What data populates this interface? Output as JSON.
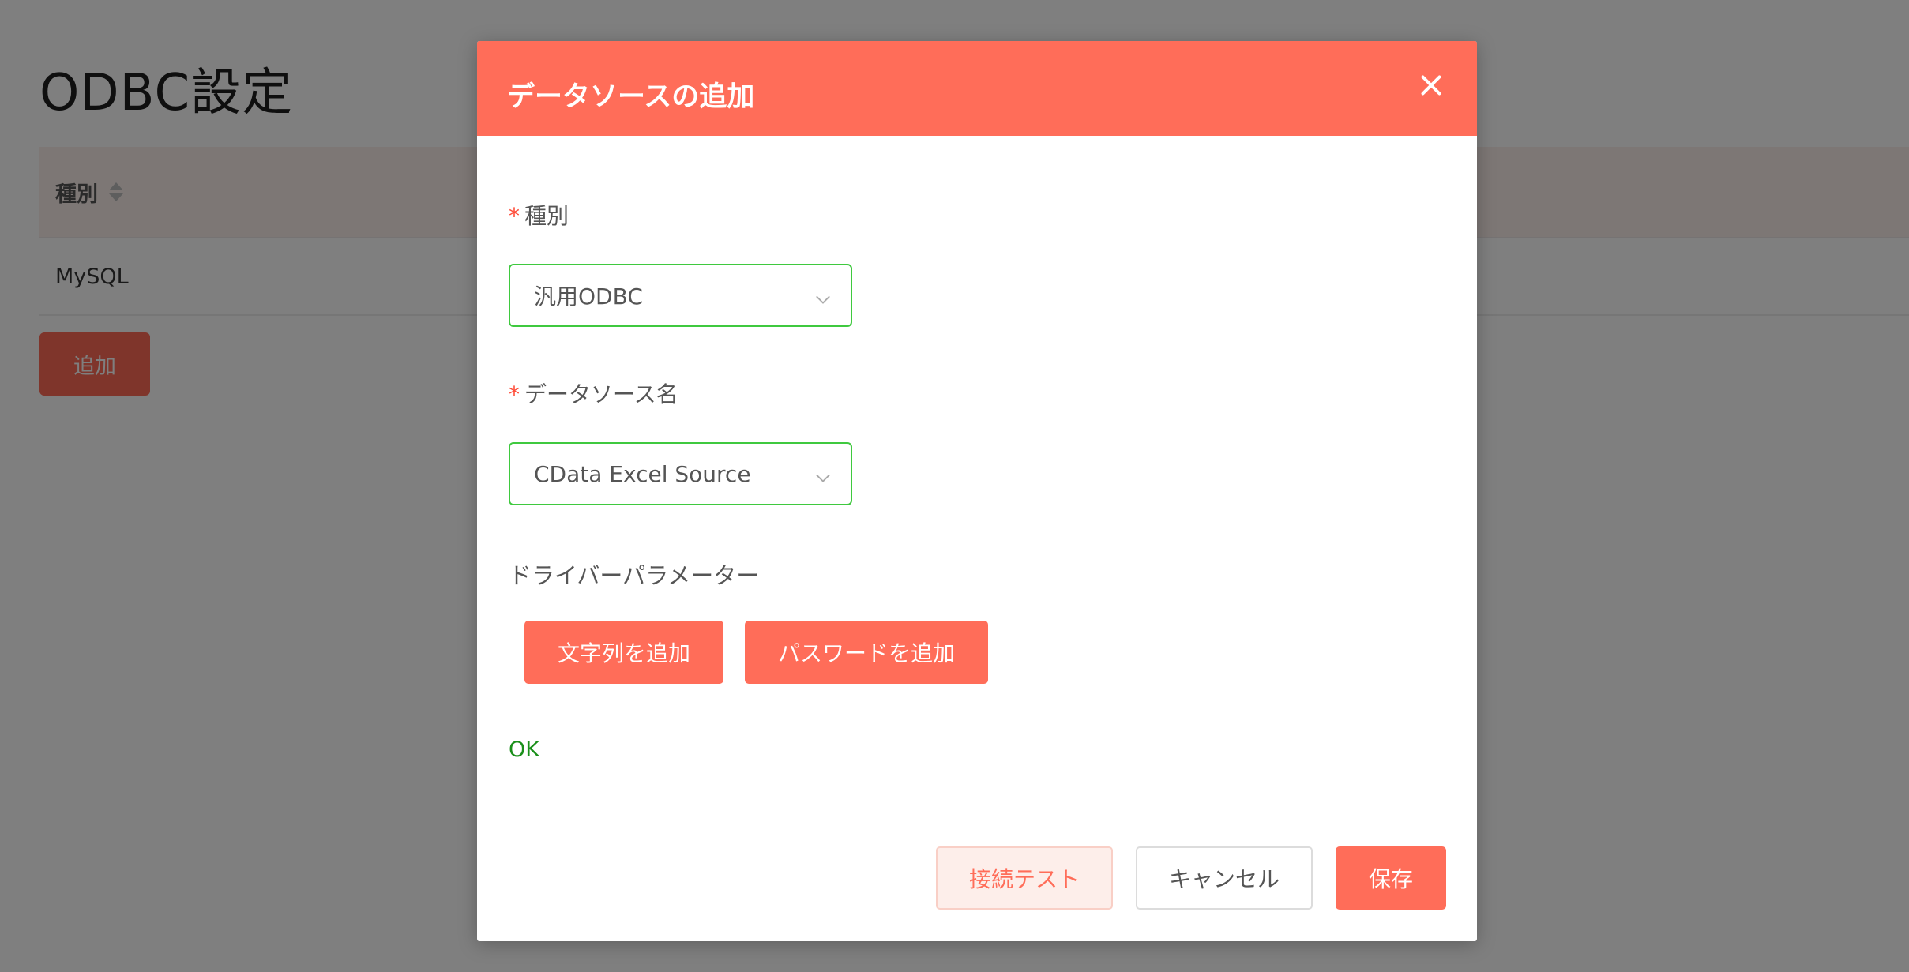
{
  "page": {
    "title": "ODBC設定",
    "table": {
      "columns": [
        {
          "label": "種別"
        }
      ],
      "rows": [
        {
          "type": "MySQL"
        }
      ]
    },
    "add_button_label": "追加"
  },
  "dialog": {
    "title": "データソースの追加",
    "close_icon": "close-icon",
    "fields": {
      "type": {
        "required_mark": "*",
        "label": "種別",
        "value": "汎用ODBC"
      },
      "datasource_name": {
        "required_mark": "*",
        "label": "データソース名",
        "value": "CData Excel Source"
      }
    },
    "driver_params": {
      "label": "ドライバーパラメーター",
      "add_string_label": "文字列を追加",
      "add_password_label": "パスワードを追加"
    },
    "status_text": "OK",
    "footer": {
      "test_label": "接続テスト",
      "cancel_label": "キャンセル",
      "save_label": "保存"
    }
  },
  "colors": {
    "accent": "#ff6d59",
    "valid_border": "#3fc93f",
    "ok_text": "#1a8f1a",
    "overlay": "rgba(0,0,0,0.5)"
  }
}
